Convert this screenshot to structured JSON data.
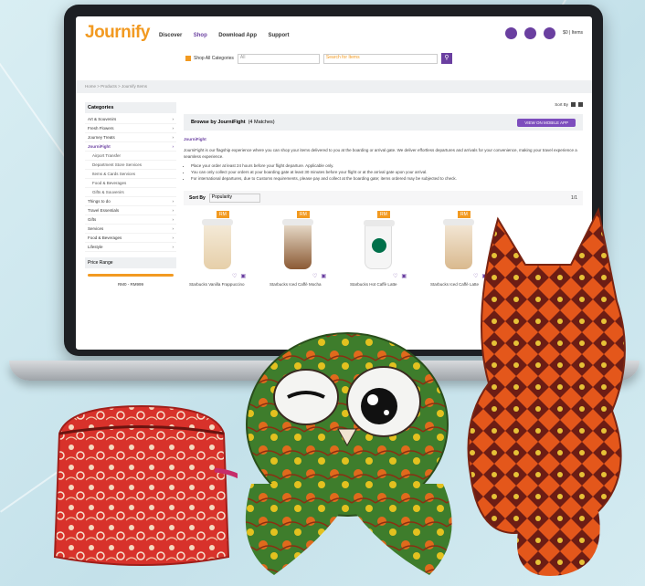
{
  "app": {
    "logo": "Journify"
  },
  "nav": {
    "items": [
      "Discover",
      "Shop",
      "Download App",
      "Support"
    ],
    "active": "Shop"
  },
  "header": {
    "cart_text": "$0 | Items"
  },
  "search": {
    "category_label": "Shop All Categories",
    "select_value": "All",
    "placeholder": "Search for Items"
  },
  "breadcrumb": "Home > Products > Journify Items",
  "sidebar": {
    "title": "Categories",
    "items": [
      {
        "label": "Art & Souvenirs",
        "sub": false,
        "active": false
      },
      {
        "label": "Fresh Flowers",
        "sub": false,
        "active": false
      },
      {
        "label": "Journey Treats",
        "sub": false,
        "active": false
      },
      {
        "label": "JourniFight",
        "sub": false,
        "active": true
      },
      {
        "label": "Airport Transfer",
        "sub": true,
        "active": false
      },
      {
        "label": "Department Store Services",
        "sub": true,
        "active": false
      },
      {
        "label": "Items & Cards Services",
        "sub": true,
        "active": false
      },
      {
        "label": "Food & Beverages",
        "sub": true,
        "active": false
      },
      {
        "label": "Gifts & Souvenirs",
        "sub": true,
        "active": false
      },
      {
        "label": "Things to do",
        "sub": false,
        "active": false
      },
      {
        "label": "Travel Essentials",
        "sub": false,
        "active": false
      },
      {
        "label": "Gifts",
        "sub": false,
        "active": false
      },
      {
        "label": "Services",
        "sub": false,
        "active": false
      },
      {
        "label": "Food & Beverages",
        "sub": false,
        "active": false
      },
      {
        "label": "Lifestyle",
        "sub": false,
        "active": false
      }
    ],
    "price_range_label": "Price Range",
    "price_range_value": "RM0 - RM999"
  },
  "main": {
    "sort_by_top": "Sort By",
    "browse_title": "Browse by JourniFight",
    "browse_count": "(4 Matches)",
    "view_button": "VIEW ON MOBILE APP",
    "desc_title": "JourniFight",
    "desc_text": "JourniFight is our flagship experience where you can shop your items delivered to you at the boarding or arrival gate. We deliver effortless departures and arrivals for your convenience, making your travel experience a seamless experience.",
    "bullets": [
      "Place your order at least 24 hours before your flight departure. Applicable only.",
      "You can only collect your orders at your boarding gate at least 30 minutes before your flight or at the arrival gate upon your arrival.",
      "For international departures, due to Customs requirements, please pay and collect at the boarding gate; items ordered may be subjected to check."
    ],
    "sort_label": "Sort By",
    "sort_value": "Popularity",
    "pager": "1/1",
    "products": [
      {
        "price": "RM",
        "name": "Starbucks Vanilla Frappuccino"
      },
      {
        "price": "RM",
        "name": "Starbucks Iced Caffè Mocha"
      },
      {
        "price": "RM",
        "name": "Starbucks Hot Caffè Latte"
      },
      {
        "price": "RM",
        "name": "Starbucks Iced Caffè Latte"
      }
    ]
  },
  "colors": {
    "brand_purple": "#6a3fa0",
    "brand_orange": "#f29a21"
  }
}
